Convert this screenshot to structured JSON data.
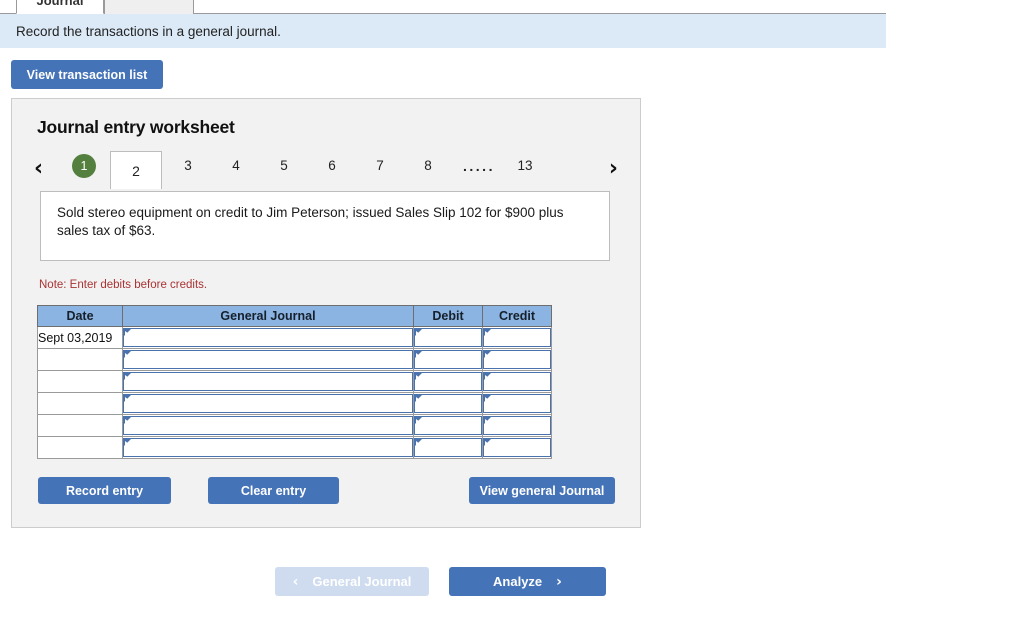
{
  "tabs": [
    {
      "label": "Journal",
      "active": true
    },
    {
      "label": "",
      "active": false
    }
  ],
  "banner": {
    "instruction": "Record the transactions in a general journal."
  },
  "toolbar": {
    "view_transaction_list_label": "View transaction list"
  },
  "worksheet": {
    "title": "Journal entry worksheet",
    "pager": {
      "prev_icon": "‹",
      "next_icon": "›",
      "items": [
        {
          "label": "1",
          "state": "done"
        },
        {
          "label": "2",
          "state": "current"
        },
        {
          "label": "3",
          "state": "normal"
        },
        {
          "label": "4",
          "state": "normal"
        },
        {
          "label": "5",
          "state": "normal"
        },
        {
          "label": "6",
          "state": "normal"
        },
        {
          "label": "7",
          "state": "normal"
        },
        {
          "label": "8",
          "state": "normal"
        },
        {
          "label": ".....",
          "state": "dots"
        },
        {
          "label": "13",
          "state": "normal"
        }
      ]
    },
    "transaction_text": "Sold stereo equipment on credit to Jim Peterson; issued Sales Slip 102 for $900 plus sales tax of $63.",
    "note": "Note: Enter debits before credits.",
    "table": {
      "headers": [
        "Date",
        "General Journal",
        "Debit",
        "Credit"
      ],
      "rows": [
        {
          "date": "Sept 03,2019",
          "general_journal": "",
          "debit": "",
          "credit": ""
        },
        {
          "date": "",
          "general_journal": "",
          "debit": "",
          "credit": ""
        },
        {
          "date": "",
          "general_journal": "",
          "debit": "",
          "credit": ""
        },
        {
          "date": "",
          "general_journal": "",
          "debit": "",
          "credit": ""
        },
        {
          "date": "",
          "general_journal": "",
          "debit": "",
          "credit": ""
        },
        {
          "date": "",
          "general_journal": "",
          "debit": "",
          "credit": ""
        }
      ]
    },
    "actions": {
      "record_entry_label": "Record entry",
      "clear_entry_label": "Clear entry",
      "view_general_journal_label": "View general Journal"
    }
  },
  "footer_nav": {
    "prev_label": "General Journal",
    "prev_icon": "‹",
    "prev_disabled": true,
    "next_label": "Analyze",
    "next_icon": "›"
  },
  "colors": {
    "accent_blue": "#4573b8",
    "banner_blue": "#dceaf7",
    "table_header_blue": "#8cb4e2",
    "field_border_blue": "#4a73ae",
    "done_green": "#54803f",
    "note_red": "#aa3333",
    "disabled_blue": "#cfdcef",
    "panel_gray": "#f2f2f2"
  }
}
